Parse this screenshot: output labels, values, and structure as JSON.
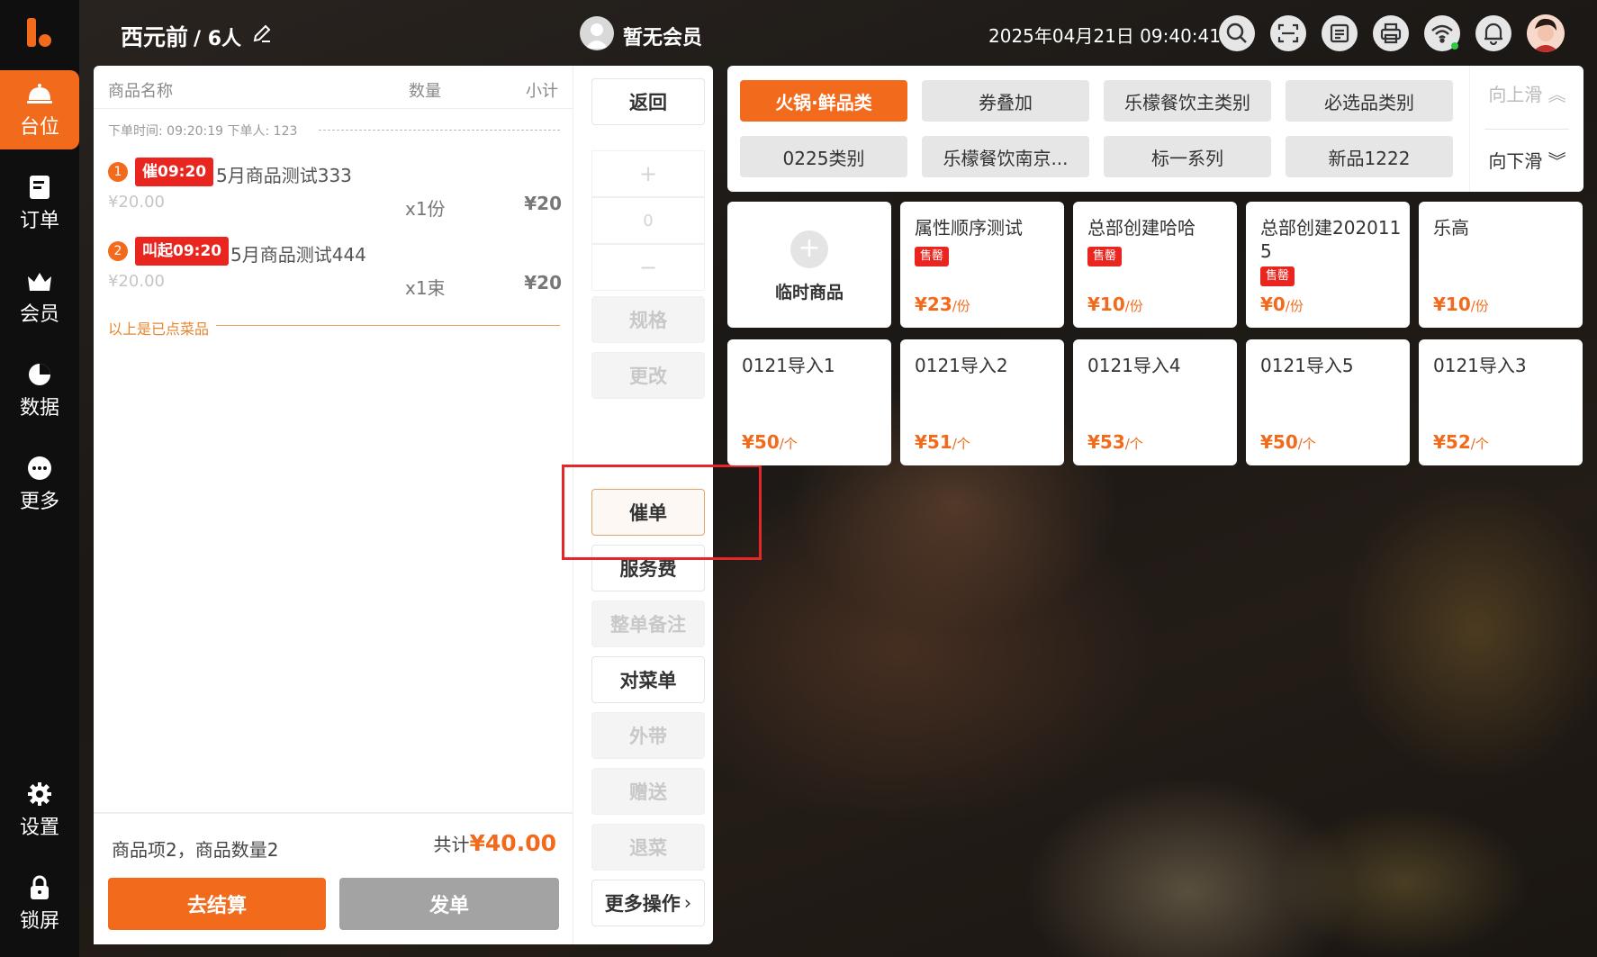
{
  "colors": {
    "accent": "#f26a1b",
    "sold_red": "#e8251e",
    "highlight_frame": "#e5262a"
  },
  "sidebar": {
    "items": [
      {
        "label": "台位",
        "icon": "table-icon"
      },
      {
        "label": "订单",
        "icon": "order-icon"
      },
      {
        "label": "会员",
        "icon": "member-icon"
      },
      {
        "label": "数据",
        "icon": "chart-icon"
      },
      {
        "label": "更多",
        "icon": "more-icon"
      },
      {
        "label": "设置",
        "icon": "gear-icon"
      },
      {
        "label": "锁屏",
        "icon": "lock-icon"
      }
    ]
  },
  "header": {
    "table_name": "西元前",
    "guests": "/ 6人",
    "member_label": "暂无会员",
    "datetime": "2025年04月21日 09:40:41"
  },
  "order": {
    "columns": {
      "name": "商品名称",
      "qty": "数量",
      "subtotal": "小计"
    },
    "meta": "下单时间: 09:20:19    下单人: 123",
    "items": [
      {
        "index": "1",
        "tag": "催09:20",
        "name": "5月商品测试333",
        "price": "¥20.00",
        "qty": "x1份",
        "subtotal": "¥20"
      },
      {
        "index": "2",
        "tag": "叫起09:20",
        "name": "5月商品测试444",
        "price": "¥20.00",
        "qty": "x1束",
        "subtotal": "¥20"
      }
    ],
    "ordered_label": "以上是已点菜品",
    "summary": "商品项2，商品数量2",
    "total_label": "共计",
    "total_amount": "¥40.00",
    "checkout_label": "去结算",
    "send_label": "发单"
  },
  "actions": {
    "back": "返回",
    "plus": "+",
    "count": "0",
    "minus": "−",
    "spec": "规格",
    "modify": "更改",
    "urge": "催单",
    "service_fee": "服务费",
    "order_note": "整单备注",
    "check_menu": "对菜单",
    "takeout": "外带",
    "gift": "赠送",
    "return": "退菜",
    "more": "更多操作"
  },
  "categories": {
    "items": [
      {
        "label": "火锅·鲜品类",
        "active": true
      },
      {
        "label": "券叠加"
      },
      {
        "label": "乐檬餐饮主类别"
      },
      {
        "label": "必选品类别"
      },
      {
        "label": "0225类别"
      },
      {
        "label": "乐檬餐饮南京..."
      },
      {
        "label": "标一系列"
      },
      {
        "label": "新品1222"
      }
    ],
    "scroll_up": "向上滑",
    "scroll_down": "向下滑"
  },
  "dishes": {
    "temp_label": "临时商品",
    "sold_label": "售罄",
    "items": [
      {
        "name": "属性顺序测试",
        "sold_out": true,
        "price": "¥23",
        "unit": "/份"
      },
      {
        "name": "总部创建哈哈",
        "sold_out": true,
        "price": "¥10",
        "unit": "/份"
      },
      {
        "name": "总部创建2020115",
        "sold_out": true,
        "price": "¥0",
        "unit": "/份"
      },
      {
        "name": "乐高",
        "sold_out": false,
        "price": "¥10",
        "unit": "/份"
      },
      {
        "name": "0121导入1",
        "sold_out": false,
        "price": "¥50",
        "unit": "/个"
      },
      {
        "name": "0121导入2",
        "sold_out": false,
        "price": "¥51",
        "unit": "/个"
      },
      {
        "name": "0121导入4",
        "sold_out": false,
        "price": "¥53",
        "unit": "/个"
      },
      {
        "name": "0121导入5",
        "sold_out": false,
        "price": "¥50",
        "unit": "/个"
      },
      {
        "name": "0121导入3",
        "sold_out": false,
        "price": "¥52",
        "unit": "/个"
      }
    ]
  }
}
